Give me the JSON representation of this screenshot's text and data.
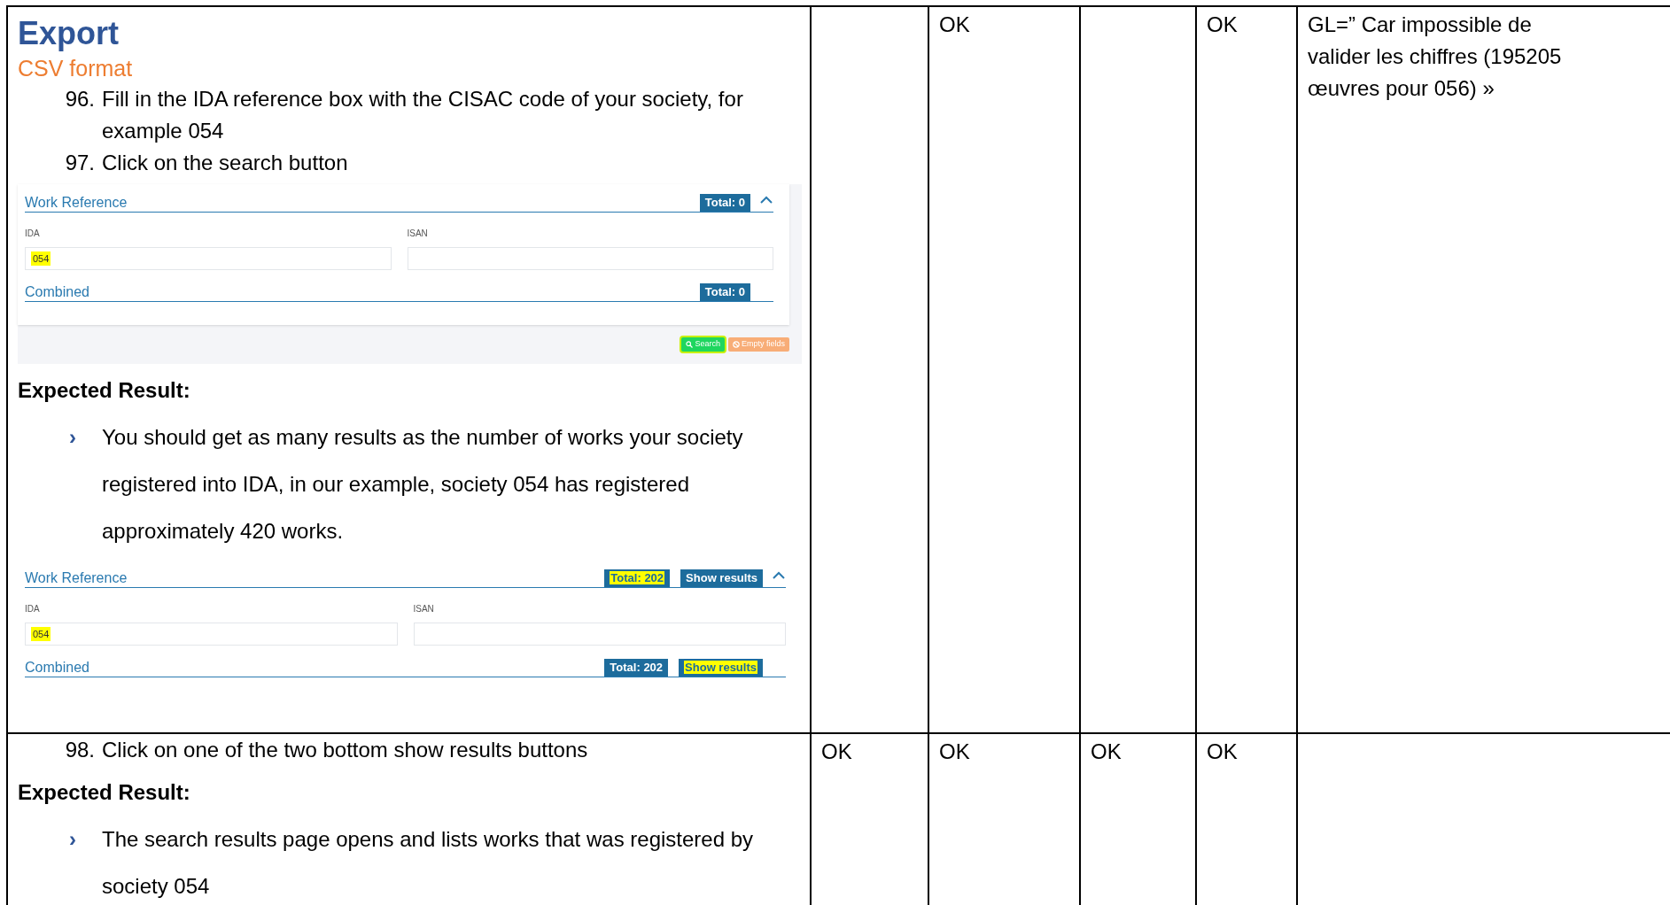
{
  "table": {
    "rows": [
      {
        "content": [
          {
            "kind": "heading",
            "text": "Export"
          },
          {
            "kind": "subheading",
            "text": "CSV format"
          },
          {
            "kind": "step",
            "number": "96.",
            "text": "Fill in the IDA reference box with the CISAC code of your society, for example 054"
          },
          {
            "kind": "step",
            "number": "97.",
            "text": "Click on the search button"
          },
          {
            "kind": "screenshot",
            "footer": true,
            "sections": [
              {
                "title": "Work Reference",
                "toggle": true,
                "badges": [
                  {
                    "label": "Total: 0",
                    "highlighted": false
                  }
                ],
                "fields": [
                  {
                    "label": "IDA",
                    "value": "054",
                    "highlighted": true
                  },
                  {
                    "label": "ISAN"
                  }
                ]
              },
              {
                "title": "Combined",
                "toggle": false,
                "badges": [
                  {
                    "label": "Total: 0",
                    "highlighted": false
                  }
                ]
              }
            ],
            "buttons": [
              {
                "kind": "search",
                "label": "Search",
                "highlighted": true
              },
              {
                "kind": "clear",
                "label": "Empty fields",
                "highlighted": false
              }
            ]
          },
          {
            "kind": "label",
            "text": "Expected Result:"
          },
          {
            "kind": "bullet",
            "marker": "›",
            "text": "You should get as many results as the number of works your society registered into IDA, in our example, society 054 has registered approximately 420 works."
          },
          {
            "kind": "screenshot",
            "footer": false,
            "sections": [
              {
                "title": "Work Reference",
                "toggle": true,
                "badges": [
                  {
                    "label": "Total: 202",
                    "highlighted": true
                  },
                  {
                    "label": "Show results",
                    "highlighted": false
                  }
                ],
                "fields": [
                  {
                    "label": "IDA",
                    "value": "054",
                    "highlighted": true
                  },
                  {
                    "label": "ISAN"
                  }
                ]
              },
              {
                "title": "Combined",
                "toggle": false,
                "badges": [
                  {
                    "label": "Total: 202",
                    "highlighted": false
                  },
                  {
                    "label": "Show results",
                    "highlighted": true
                  }
                ]
              }
            ]
          }
        ],
        "cells": [
          null,
          "OK",
          null,
          "OK",
          "GL=” Car impossible de valider les chiffres (195205 œuvres pour 056) »"
        ]
      },
      {
        "content": [
          {
            "kind": "step",
            "number": "98.",
            "text": "Click on one of the two bottom show results buttons"
          },
          {
            "kind": "label",
            "text": "Expected Result:"
          },
          {
            "kind": "bullet",
            "marker": "›",
            "text": "The search results page opens and lists works that was registered by society 054"
          }
        ],
        "cells": [
          "OK",
          "OK",
          "OK",
          "OK",
          null
        ]
      }
    ]
  }
}
